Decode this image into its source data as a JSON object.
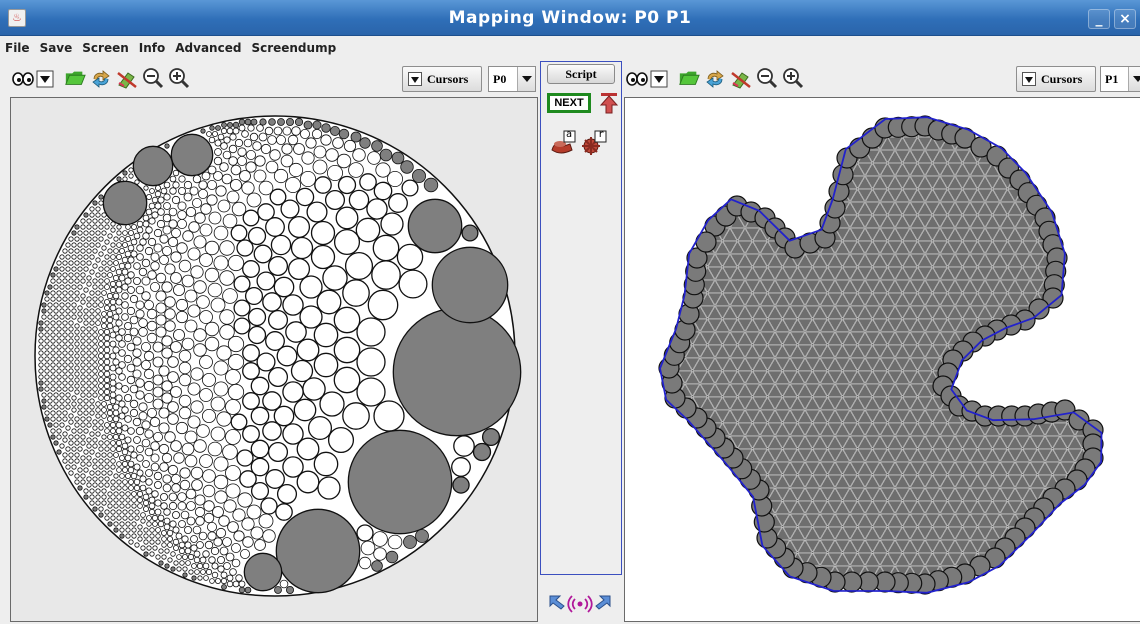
{
  "window": {
    "title": "Mapping Window:  P0  P1",
    "minimize": "_",
    "close": "×"
  },
  "menu": [
    "File",
    "Save",
    "Screen",
    "Info",
    "Advanced",
    "Screendump"
  ],
  "left_pane": {
    "cursors_label": "Cursors",
    "packing_selector": "P0"
  },
  "right_pane": {
    "cursors_label": "Cursors",
    "packing_selector": "P1"
  },
  "middle": {
    "script_label": "Script",
    "next_label": "NEXT",
    "icon_a_badge": "a",
    "icon_r_badge": "r"
  },
  "icons": {
    "toolbar": [
      "eyes-icon",
      "dropdown-icon",
      "folder-icon",
      "refresh-icon",
      "erase-icon",
      "zoom-out-icon",
      "zoom-in-icon"
    ],
    "colors": {
      "title_bar": "#3a7cc6",
      "border_blue": "#2222cc",
      "circle_gray": "#808080",
      "next_border": "#1f8a1f"
    }
  }
}
